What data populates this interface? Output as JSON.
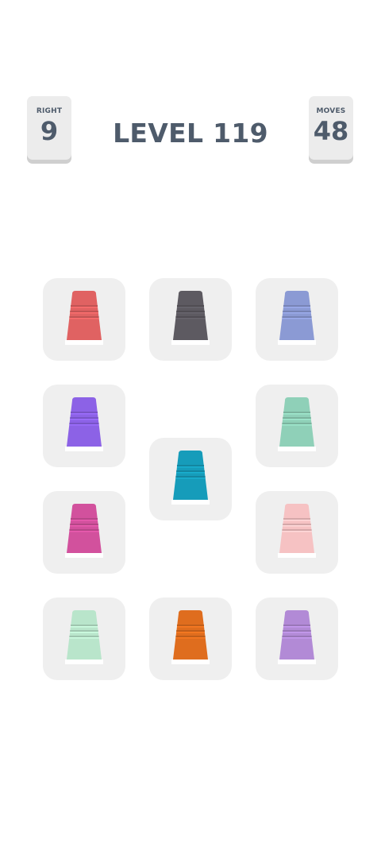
{
  "header": {
    "right": {
      "label": "RIGHT",
      "value": "9"
    },
    "moves": {
      "label": "MOVES",
      "value": "48"
    },
    "level_title": "LEVEL 119"
  },
  "cups": [
    {
      "id": "red",
      "color": "#e06262"
    },
    {
      "id": "dark-gray",
      "color": "#5d5a61"
    },
    {
      "id": "periwinkle",
      "color": "#8b9ad4"
    },
    {
      "id": "purple",
      "color": "#8c62e6"
    },
    {
      "id": "mint",
      "color": "#8fd0b8"
    },
    {
      "id": "teal",
      "color": "#169cba"
    },
    {
      "id": "magenta",
      "color": "#d2519d"
    },
    {
      "id": "pink",
      "color": "#f6c2c3"
    },
    {
      "id": "light-green",
      "color": "#b9e5cb"
    },
    {
      "id": "orange",
      "color": "#df6d1e"
    },
    {
      "id": "lavender",
      "color": "#b28ad6"
    }
  ]
}
